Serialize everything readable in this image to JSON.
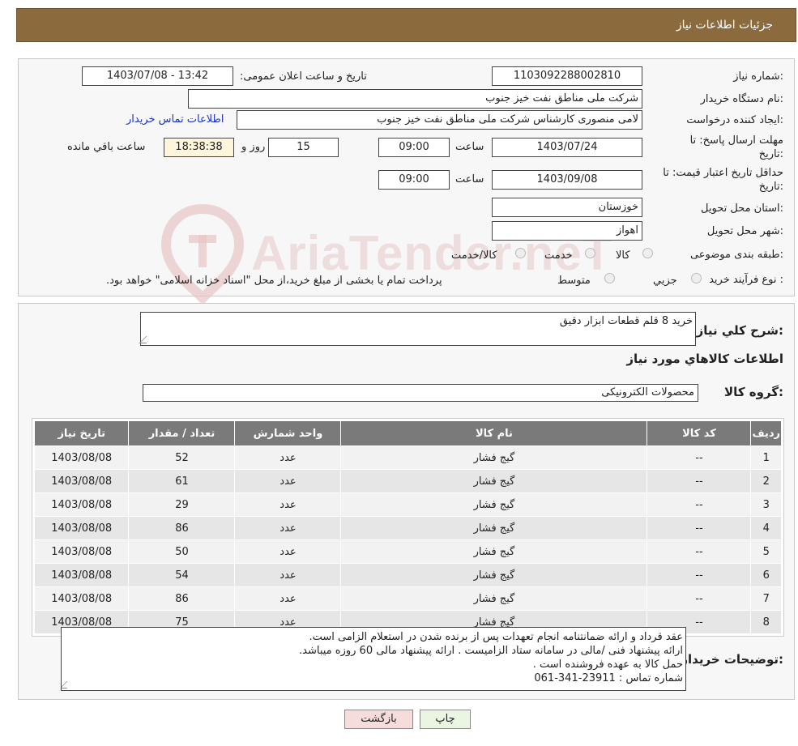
{
  "header": {
    "title": "جزئیات اطلاعات نیاز"
  },
  "watermark": "AriaTender.neT",
  "form": {
    "need_number_label": "شماره نیاز:",
    "need_number": "1103092288002810",
    "announce_label": "تاریخ و ساعت اعلان عمومی:",
    "announce_value": "1403/07/08 - 13:42",
    "buyer_label": "نام دستگاه خریدار:",
    "buyer_value": "شرکت ملی مناطق نفت خیز جنوب",
    "creator_label": "ایجاد کننده درخواست:",
    "creator_value": "لامی منصوری کارشناس شرکت ملی مناطق نفت خیز جنوب",
    "contact_link": "اطلاعات تماس خریدار",
    "deadline_label_1": "مهلت ارسال پاسخ: تا",
    "deadline_label_2": "تاریخ:",
    "deadline_date": "1403/07/24",
    "time_label": "ساعت",
    "deadline_time": "09:00",
    "days_value": "15",
    "days_label": "روز و",
    "remaining_time": "18:38:38",
    "remaining_label": "ساعت باقي مانده",
    "validity_label_1": "حداقل تاریخ اعتبار قیمت: تا",
    "validity_label_2": "تاریخ:",
    "validity_date": "1403/09/08",
    "validity_time": "09:00",
    "province_label": "استان محل تحویل:",
    "province_value": "خوزستان",
    "city_label": "شهر محل تحویل:",
    "city_value": "اهواز",
    "category_label": "طبقه بندی موضوعی:",
    "category_options": [
      "کالا",
      "خدمت",
      "کالا/خدمت"
    ],
    "process_label": "نوع فرآیند خرید :",
    "process_options": [
      "جزیي",
      "متوسط"
    ],
    "process_note": "پرداخت تمام یا بخشی از مبلغ خرید،از محل \"اسناد خزانه اسلامی\" خواهد بود."
  },
  "details": {
    "summary_label": "شرح کلي نياز:",
    "summary_value": "خرید 8 قلم قطعات ابزار دقیق",
    "items_heading": "اطلاعات کالاهاي مورد نياز",
    "group_label": "گروه کالا:",
    "group_value": "محصولات الکترونیکی",
    "table": {
      "headers": [
        "رديف",
        "کد کالا",
        "نام کالا",
        "واحد شمارش",
        "تعداد / مقدار",
        "تاريخ نياز"
      ],
      "rows": [
        [
          "1",
          "--",
          "گیج فشار",
          "عدد",
          "52",
          "1403/08/08"
        ],
        [
          "2",
          "--",
          "گیج فشار",
          "عدد",
          "61",
          "1403/08/08"
        ],
        [
          "3",
          "--",
          "گیج فشار",
          "عدد",
          "29",
          "1403/08/08"
        ],
        [
          "4",
          "--",
          "گیج فشار",
          "عدد",
          "86",
          "1403/08/08"
        ],
        [
          "5",
          "--",
          "گیج فشار",
          "عدد",
          "50",
          "1403/08/08"
        ],
        [
          "6",
          "--",
          "گیج فشار",
          "عدد",
          "54",
          "1403/08/08"
        ],
        [
          "7",
          "--",
          "گیج فشار",
          "عدد",
          "86",
          "1403/08/08"
        ],
        [
          "8",
          "--",
          "گیج فشار",
          "عدد",
          "75",
          "1403/08/08"
        ]
      ]
    },
    "notes_label": "توضیحات خریدار:",
    "notes_lines": [
      "عقد قرداد و ارائه ضمانتنامه انجام تعهدات پس از برنده شدن در استعلام الزامی است.",
      "ارائه پیشنهاد فنی /مالی در سامانه ستاد الزامیست . ارائه پیشنهاد مالی 60 روزه میباشد.",
      "حمل کالا به عهده فروشنده است .",
      "شماره تماس : 23911-341-061"
    ]
  },
  "buttons": {
    "print": "چاپ",
    "back": "بازگشت"
  }
}
